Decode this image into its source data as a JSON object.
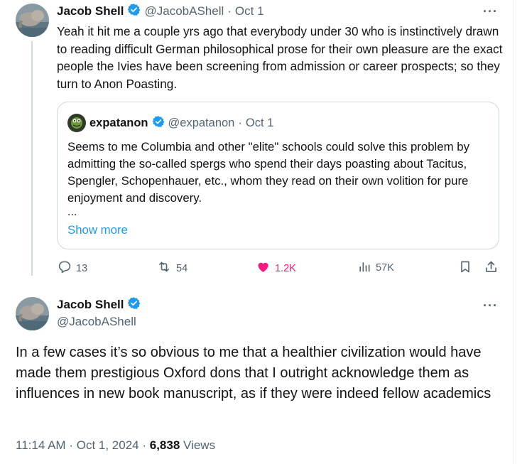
{
  "tweet1": {
    "author_name": "Jacob Shell",
    "author_handle": "@JacobAShell",
    "separator": "·",
    "date": "Oct 1",
    "text": "Yeah it hit me a couple yrs ago that everybody under 30 who is instinctively drawn to reading difficult German philosophical prose for their own pleasure are the exact people the Ivies have been screening from admission or career prospects; so they turn to Anon Poasting.",
    "more_label": "···"
  },
  "quote": {
    "author_name": "expatanon",
    "author_handle": "@expatanon",
    "separator": "·",
    "date": "Oct 1",
    "text": "Seems to me Columbia and other \"elite\" schools could solve this problem by admitting the so-called spergs who spend their days poasting about Tacitus, Spengler, Schopenhauer, etc., whom they read on their own volition for pure enjoyment and discovery.",
    "ellipsis": "...",
    "show_more": "Show more"
  },
  "actions": {
    "replies": "13",
    "reposts": "54",
    "likes": "1.2K",
    "views": "57K"
  },
  "tweet2": {
    "author_name": "Jacob Shell",
    "author_handle": "@JacobAShell",
    "more_label": "···",
    "text": "In a few cases it’s so obvious to me that a healthier civilization would have made them prestigious Oxford dons that I outright acknowledge them as influences in new book manuscript, as if they were indeed fellow academics",
    "time": "11:14 AM",
    "dot1": "·",
    "date": "Oct 1, 2024",
    "dot2": "·",
    "views_count": "6,838",
    "views_label": "Views"
  },
  "colors": {
    "verified": "#1d9bf0",
    "like": "#f91880",
    "link": "#1d9bf0",
    "secondary_text": "#536471",
    "border": "#cfd9de"
  },
  "icons": [
    "verified-badge-icon",
    "reply-icon",
    "repost-icon",
    "heart-icon",
    "views-icon",
    "bookmark-icon",
    "share-icon",
    "more-icon"
  ]
}
